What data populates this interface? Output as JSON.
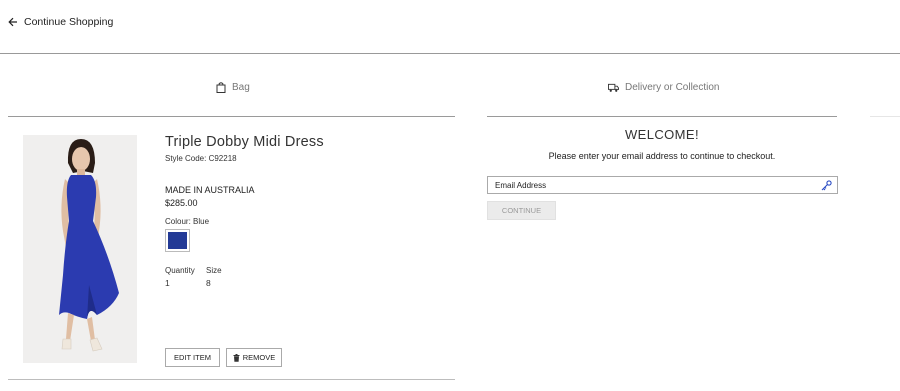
{
  "nav": {
    "back_label": "Continue Shopping"
  },
  "steps": {
    "bag": "Bag",
    "delivery": "Delivery or Collection"
  },
  "product": {
    "title": "Triple Dobby Midi Dress",
    "style_code": "Style Code: C92218",
    "origin": "MADE IN AUSTRALIA",
    "price": "$285.00",
    "colour_label": "Colour: Blue",
    "swatch_color": "#233a96",
    "quantity_label": "Quantity",
    "quantity_value": "1",
    "size_label": "Size",
    "size_value": "8",
    "edit_label": "EDIT ITEM",
    "remove_label": "REMOVE"
  },
  "checkout": {
    "welcome": "WELCOME!",
    "instructions": "Please enter your email address to continue to checkout.",
    "email_placeholder": "Email Address",
    "continue_label": "CONTINUE"
  },
  "colors": {
    "dress_blue": "#2b3bb0",
    "rule_gray": "#9a9a9a",
    "disabled_button": "#ebebeb"
  }
}
